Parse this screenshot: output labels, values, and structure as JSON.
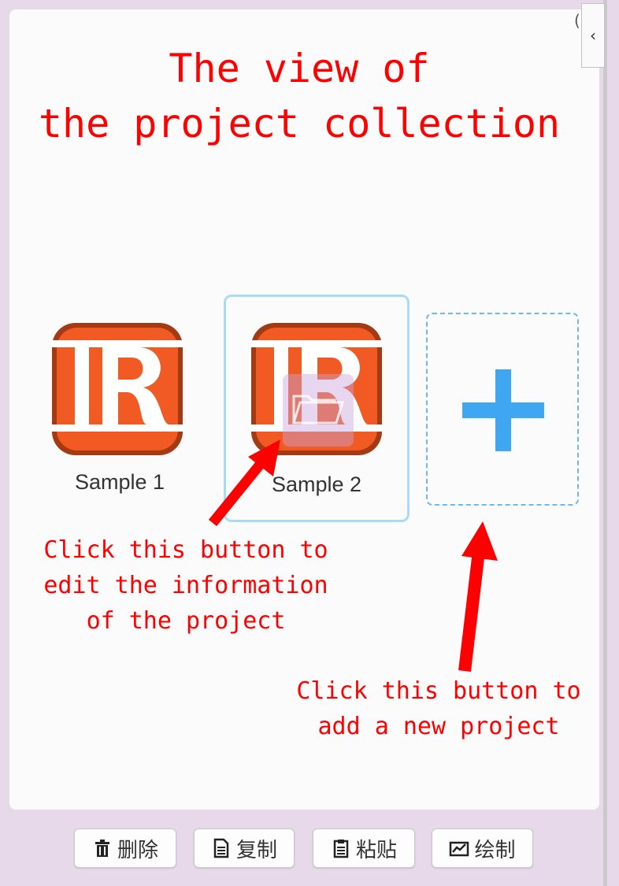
{
  "annotations": {
    "title_lines": [
      "The view of",
      "the project collection"
    ],
    "edit_note_lines": [
      "Click this button to",
      "edit the information",
      "of the project"
    ],
    "add_note_lines": [
      "Click this button to",
      "add a new project"
    ]
  },
  "projects": [
    {
      "label": "Sample 1",
      "selected": false,
      "icon": "project-logo-icon"
    },
    {
      "label": "Sample 2",
      "selected": true,
      "icon": "project-logo-icon"
    }
  ],
  "add_project": {
    "icon": "plus-icon"
  },
  "sidebar_toggle": {
    "glyph": "‹",
    "icon": "chevron-left-icon"
  },
  "corner_glyph": "(",
  "toolbar": {
    "delete": {
      "label": "删除",
      "icon": "trash-icon"
    },
    "copy": {
      "label": "复制",
      "icon": "document-icon"
    },
    "paste": {
      "label": "粘贴",
      "icon": "clipboard-icon"
    },
    "draw": {
      "label": "绘制",
      "icon": "chart-icon"
    }
  },
  "colors": {
    "background": "#e8d9ea",
    "panel": "#fbfbfb",
    "annotation": "#ff0000",
    "logo_orange": "#f15a22",
    "logo_dark": "#a33a14",
    "plus_blue": "#3fa7f2",
    "selected_border": "#a9dcf4"
  }
}
